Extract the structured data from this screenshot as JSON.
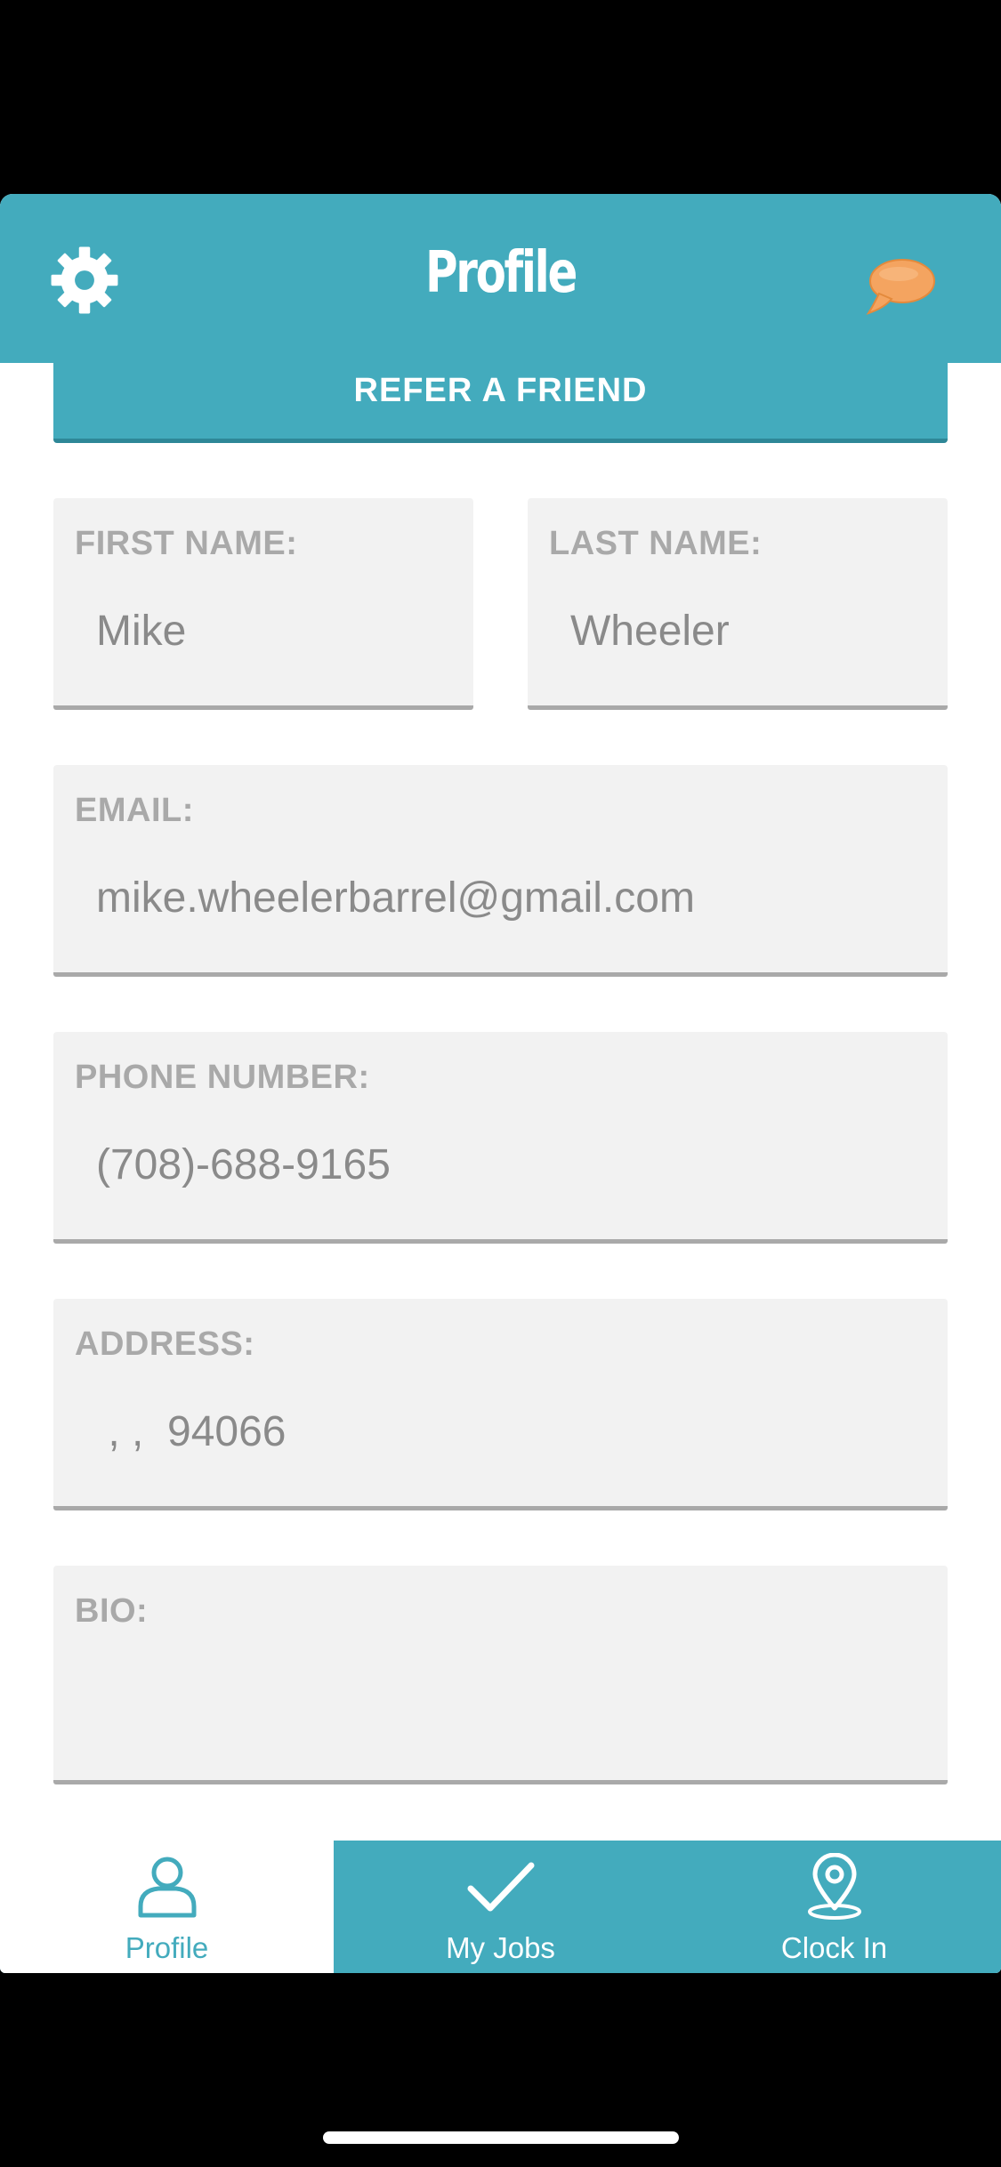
{
  "header": {
    "title": "Profile",
    "left_icon": "gear-icon",
    "right_icon": "chat-bubble-icon",
    "chat_color": "#f4a460"
  },
  "refer_button": {
    "label": "REFER A FRIEND"
  },
  "form": {
    "first_name": {
      "label": "FIRST NAME:",
      "value": "Mike"
    },
    "last_name": {
      "label": "LAST NAME:",
      "value": "Wheeler"
    },
    "email": {
      "label": "EMAIL:",
      "value": "mike.wheelerbarrel@gmail.com"
    },
    "phone": {
      "label": "PHONE NUMBER:",
      "value": "(708)-688-9165"
    },
    "address": {
      "label": "ADDRESS:",
      "value": " , ,  94066"
    },
    "bio": {
      "label": "BIO:",
      "value": ""
    }
  },
  "tabbar": {
    "tabs": [
      {
        "label": "Profile",
        "icon": "person-icon",
        "active": true
      },
      {
        "label": "My Jobs",
        "icon": "checkmark-icon",
        "active": false
      },
      {
        "label": "Clock In",
        "icon": "location-pin-icon",
        "active": false
      }
    ]
  },
  "colors": {
    "accent": "#43abbd",
    "field_bg": "#f2f2f2",
    "label_gray": "#a9a9a9"
  }
}
